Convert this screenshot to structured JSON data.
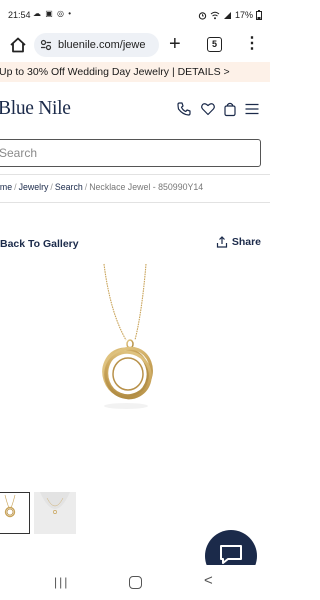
{
  "status_bar": {
    "time": "21:54",
    "left_icons": "☁ ▣ ◎ •",
    "battery": "17%"
  },
  "browser": {
    "url": "bluenile.com/jewe",
    "tab_count": "5"
  },
  "promo": {
    "text": "Up to 30% Off Wedding Day Jewelry | DETAILS >"
  },
  "header": {
    "logo": "Blue Nile",
    "icons": [
      "phone-icon",
      "heart-icon",
      "bag-icon",
      "hamburger-menu-icon"
    ]
  },
  "search": {
    "placeholder": "Search"
  },
  "breadcrumb": {
    "items": [
      "Home",
      "Jewelry",
      "Search"
    ],
    "current": "Necklace Jewel - 850990Y14",
    "first_visible": "ome"
  },
  "product": {
    "back_label": "Back To Gallery",
    "share_label": "Share",
    "thumbnails": [
      "necklace-thumbnail",
      "model-wearing-thumbnail"
    ]
  },
  "colors": {
    "brand_navy": "#1b2a4a",
    "promo_bg": "#fdf1e8",
    "gold": "#c9a45a"
  }
}
